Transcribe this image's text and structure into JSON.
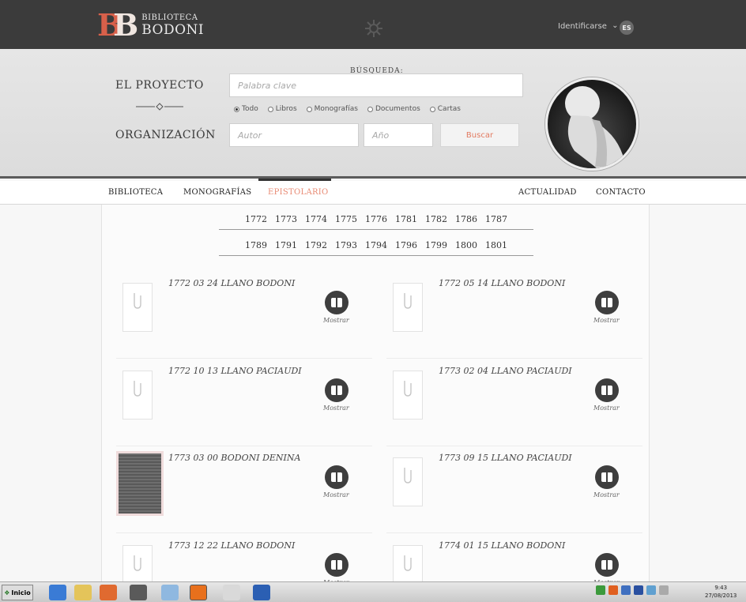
{
  "header": {
    "logo_line1": "BIBLIOTECA",
    "logo_line2": "BODONI",
    "signin_label": "Identificarse",
    "language_badge": "ES"
  },
  "search": {
    "title": "BÚSQUEDA:",
    "keyword_placeholder": "Palabra clave",
    "author_placeholder": "Autor",
    "year_placeholder": "Año",
    "button_label": "Buscar",
    "filters": [
      {
        "label": "Todo",
        "selected": true
      },
      {
        "label": "Libros",
        "selected": false
      },
      {
        "label": "Monografías",
        "selected": false
      },
      {
        "label": "Documentos",
        "selected": false
      },
      {
        "label": "Cartas",
        "selected": false
      }
    ]
  },
  "side_links": {
    "project": "EL PROYECTO",
    "organization": "ORGANIZACIÓN"
  },
  "nav": {
    "items": [
      "BIBLIOTECA",
      "MONOGRAFÍAS",
      "EPISTOLARIO",
      "ACTUALIDAD",
      "CONTACTO"
    ],
    "active": "EPISTOLARIO"
  },
  "years": {
    "row1": [
      "1772",
      "1773",
      "1774",
      "1775",
      "1776",
      "1781",
      "1782",
      "1786",
      "1787"
    ],
    "row2": [
      "1789",
      "1791",
      "1792",
      "1793",
      "1794",
      "1796",
      "1799",
      "1800",
      "1801"
    ]
  },
  "letters": [
    {
      "title": "1772 03 24 LLANO BODONI",
      "action": "Mostrar",
      "has_image": false
    },
    {
      "title": "1772 05 14 LLANO BODONI",
      "action": "Mostrar",
      "has_image": false
    },
    {
      "title": "1772 10 13 LLANO PACIAUDI",
      "action": "Mostrar",
      "has_image": false
    },
    {
      "title": "1773 02 04 LLANO PACIAUDI",
      "action": "Mostrar",
      "has_image": false
    },
    {
      "title": "1773 03 00 BODONI DENINA",
      "action": "Mostrar",
      "has_image": true
    },
    {
      "title": "1773 09 15 LLANO PACIAUDI",
      "action": "Mostrar",
      "has_image": false
    },
    {
      "title": "1773 12 22 LLANO BODONI",
      "action": "Mostrar",
      "has_image": false
    },
    {
      "title": "1774 01 15 LLANO BODONI",
      "action": "Mostrar",
      "has_image": false
    }
  ],
  "taskbar": {
    "start_label": "Inicio",
    "time": "9:43",
    "date": "27/08/2013"
  }
}
